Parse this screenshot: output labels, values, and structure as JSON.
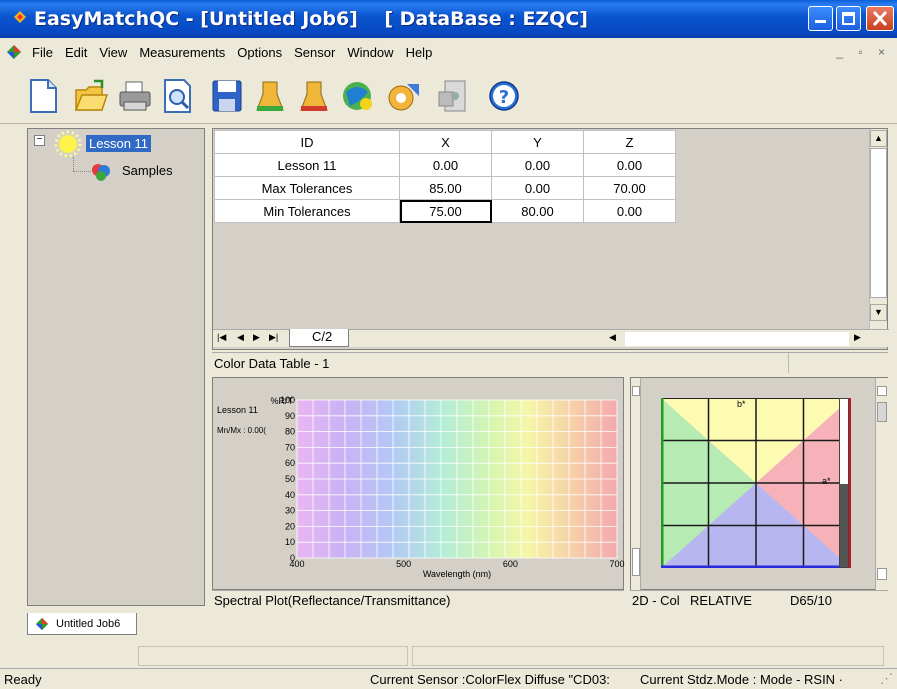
{
  "window": {
    "title": "EasyMatchQC - [Untitled Job6]    [ DataBase : EZQC]"
  },
  "menu": {
    "items": [
      "File",
      "Edit",
      "View",
      "Measurements",
      "Options",
      "Sensor",
      "Window",
      "Help"
    ]
  },
  "toolbar": {
    "icons": [
      "new-document-icon",
      "open-folder-icon",
      "print-icon",
      "print-preview-icon",
      "save-icon",
      "standardize-icon",
      "standardize-check-icon",
      "read-sample-icon",
      "sensor-settings-icon",
      "export-icon",
      "help-icon"
    ]
  },
  "tree": {
    "root_label": "Lesson 11",
    "child_label": "Samples",
    "collapse_glyph": "−"
  },
  "grid": {
    "columns": [
      "ID",
      "X",
      "Y",
      "Z"
    ],
    "rows": [
      [
        "Lesson 11",
        "0.00",
        "0.00",
        "0.00"
      ],
      [
        "Max Tolerances",
        "85.00",
        "0.00",
        "70.00"
      ],
      [
        "Min Tolerances",
        "75.00",
        "80.00",
        "0.00"
      ]
    ],
    "tab_label": "C/2",
    "status_label": "Color Data Table - 1"
  },
  "spectral": {
    "y_unit": "%R/T",
    "y_ticks": [
      "100",
      "90",
      "80",
      "70",
      "60",
      "50",
      "40",
      "30",
      "20",
      "10",
      "0"
    ],
    "x_ticks": [
      "400",
      "500",
      "600",
      "700"
    ],
    "x_label": "Wavelength (nm)",
    "legend_line1": "Lesson 11",
    "legend_line2": "Mn/Mx : 0.00(",
    "status_label": "Spectral Plot(Reflectance/Transmittance)"
  },
  "cie": {
    "b_label": "b*",
    "a_label": "a*",
    "status_mode": "2D - Col",
    "status_relative": "RELATIVE",
    "status_illum": "D65/10"
  },
  "doc_tab": {
    "label": "Untitled Job6"
  },
  "statusbar": {
    "ready": "Ready",
    "sensor": "Current Sensor :ColorFlex Diffuse \"CD03:",
    "stdz_mode": "Current Stdz.Mode :  Mode - RSIN ·"
  }
}
